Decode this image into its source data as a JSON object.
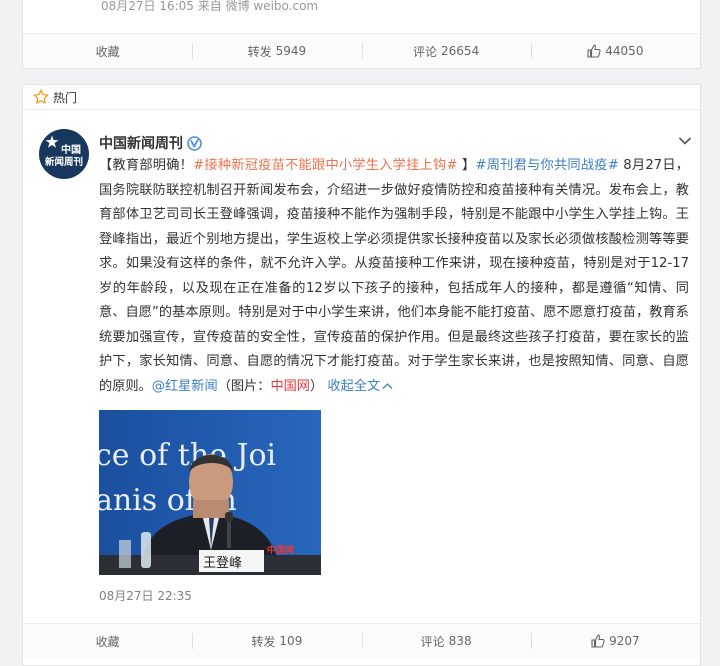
{
  "top_card": {
    "meta": "08月27日 16:05 来自 微博 weibo.com",
    "actions": {
      "favorite": "收藏",
      "repost_label": "转发",
      "repost_count": "5949",
      "comment_label": "评论",
      "comment_count": "26654",
      "like_count": "44050"
    }
  },
  "hot_section": {
    "label": "热门"
  },
  "post": {
    "author": "中国新闻周刊",
    "avatar_text": [
      "中国",
      "新闻周刊"
    ],
    "text": {
      "p1": "【教育部明确！",
      "tag1": "#接种新冠疫苗不能跟中小学生入学挂上钩#",
      "p2": " 】",
      "tag2": "#周刊君与你共同战疫#",
      "p3": " 8月27日，国务院联防联控机制召开新闻发布会，介绍进一步做好疫情防控和疫苗接种有关情况。发布会上，教育部体卫艺司司长王登峰强调，疫苗接种不能作为强制手段，特别是不能跟中小学生入学挂上钩。王登峰指出，最近个别地方提出，学生返校上学必须提供家长接种疫苗以及家长必须做核酸检测等等要求。如果没有这样的条件，就不允许入学。从疫苗接种工作来讲，现在接种疫苗，特别是对于12-17岁的年龄段，以及现在正在准备的12岁以下孩子的接种，包括成年人的接种，都是遵循“知情、同意、自愿”的基本原则。特别是对于中小学生来讲，他们本身能不能打疫苗、愿不愿意打疫苗，教育系统要加强宣传，宣传疫苗的安全性，宣传疫苗的保护作用。但是最终这些孩子打疫苗，要在家长的监护下，家长知情、同意、自愿的情况下才能打疫苗。对于学生家长来讲，也是按照知情、同意、自愿的原则。",
      "mention": "@红星新闻",
      "p4": "（图片：",
      "source_red": "中国网",
      "p5": "）",
      "collapse": "收起全文"
    },
    "image": {
      "backdrop_text_1": "ce of the Joi",
      "backdrop_text_2": "anis  of  th",
      "nameplate": "王登峰",
      "watermark": "中国网"
    },
    "time": "08月27日 22:35",
    "actions": {
      "favorite": "收藏",
      "repost_label": "转发",
      "repost_count": "109",
      "comment_label": "评论",
      "comment_count": "838",
      "like_count": "9207"
    }
  },
  "colors": {
    "link_orange": "#eb7350",
    "link_blue": "#3c7fc4",
    "verified": "#4a90e2",
    "star": "#f0a020"
  }
}
